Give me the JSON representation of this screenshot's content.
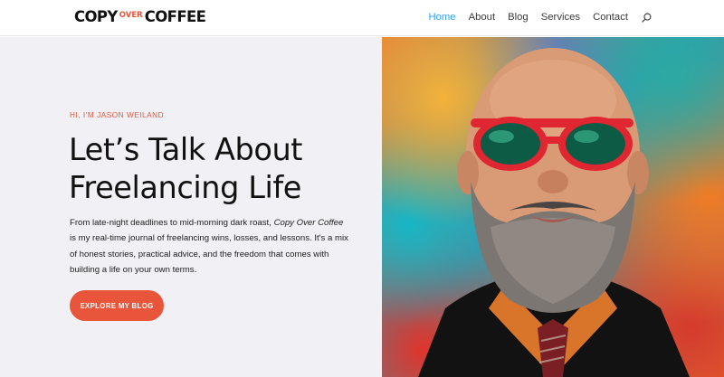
{
  "header": {
    "logo": {
      "part1": "COPY",
      "part2": "OVER",
      "part3": "COFFEE"
    },
    "nav": [
      {
        "label": "Home",
        "active": true
      },
      {
        "label": "About",
        "active": false
      },
      {
        "label": "Blog",
        "active": false
      },
      {
        "label": "Services",
        "active": false
      },
      {
        "label": "Contact",
        "active": false
      }
    ],
    "search_icon": "search-icon"
  },
  "hero": {
    "eyebrow": "HI, I'M JASON WEILAND",
    "headline_line1": "Let’s Talk About",
    "headline_line2": "Freelancing Life",
    "intro_part1": "From late-night deadlines to mid-morning dark roast,",
    "intro_italic": "Copy Over Coffee",
    "intro_part2": "is my real-time journal of freelancing wins, losses, and lessons. It's a mix of honest stories, practical advice, and the freedom that comes with building a life on your own terms.",
    "cta_label": "EXPLORE MY BLOG"
  },
  "colors": {
    "accent": "#e8553a",
    "nav_active": "#2ea3f2",
    "hero_left_bg": "#f0f0f5"
  }
}
